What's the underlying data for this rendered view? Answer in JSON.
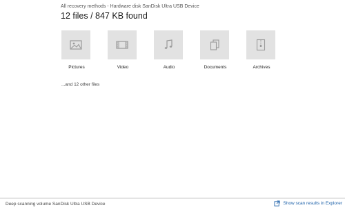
{
  "header": {
    "breadcrumb": "All recovery methods - Hardware disk SanDisk Ultra USB Device",
    "summary": "12 files / 847 KB found"
  },
  "categories": [
    {
      "label": "Pictures",
      "icon": "picture-icon"
    },
    {
      "label": "Video",
      "icon": "film-icon"
    },
    {
      "label": "Audio",
      "icon": "music-note-icon"
    },
    {
      "label": "Documents",
      "icon": "documents-icon"
    },
    {
      "label": "Archives",
      "icon": "archive-icon"
    }
  ],
  "other_files": "...and 12 other files",
  "footer": {
    "status": "Deep scanning volume SanDisk Ultra USB Device",
    "explorer_link": "Show scan results in Explorer",
    "progress_fraction": 0.0
  },
  "colors": {
    "tile": "#e2e2e2",
    "icon": "#9a9a9a",
    "link": "#1a5fa8"
  }
}
